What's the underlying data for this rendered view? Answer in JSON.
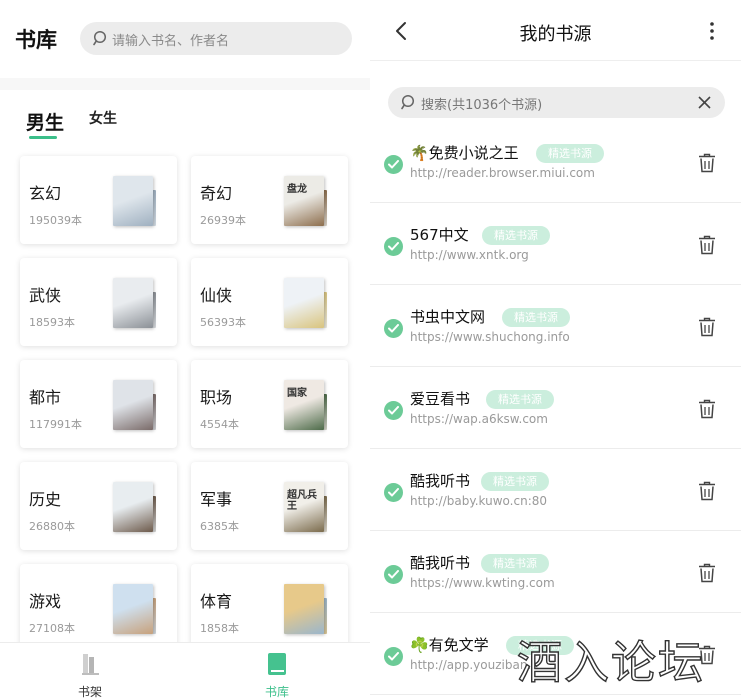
{
  "library": {
    "title": "书库",
    "search_placeholder": "请输入书名、作者名",
    "gender_tabs": {
      "male": "男生",
      "female": "女生"
    },
    "categories": [
      {
        "name": "玄幻",
        "count": "195039本",
        "cover_text": "",
        "colors": [
          "#dfe6ec",
          "#9fb0c0"
        ]
      },
      {
        "name": "奇幻",
        "count": "26939本",
        "cover_text": "盘龙",
        "colors": [
          "#ecebe6",
          "#8d6e4d"
        ]
      },
      {
        "name": "武侠",
        "count": "18593本",
        "cover_text": "",
        "colors": [
          "#e9ecef",
          "#8b9096"
        ]
      },
      {
        "name": "仙侠",
        "count": "56393本",
        "cover_text": "",
        "colors": [
          "#eef2f6",
          "#d9c47e"
        ]
      },
      {
        "name": "都市",
        "count": "117991本",
        "cover_text": "",
        "colors": [
          "#dfe3e8",
          "#7a6b69"
        ]
      },
      {
        "name": "职场",
        "count": "4554本",
        "cover_text": "国家",
        "colors": [
          "#efe9e3",
          "#4d6b49"
        ]
      },
      {
        "name": "历史",
        "count": "26880本",
        "cover_text": "",
        "colors": [
          "#e8edf0",
          "#6d5a4b"
        ]
      },
      {
        "name": "军事",
        "count": "6385本",
        "cover_text": "超凡兵王",
        "colors": [
          "#f1efe9",
          "#7b6b4c"
        ]
      },
      {
        "name": "游戏",
        "count": "27108本",
        "cover_text": "",
        "colors": [
          "#cfe0ef",
          "#c7a17c"
        ]
      },
      {
        "name": "体育",
        "count": "1858本",
        "cover_text": "",
        "colors": [
          "#e7c98a",
          "#9ab6cc"
        ]
      }
    ],
    "nav": {
      "shelf": "书架",
      "library": "书库"
    },
    "accent": "#3bbf8a"
  },
  "sources": {
    "title": "我的书源",
    "search_placeholder": "搜索(共1036个书源)",
    "items": [
      {
        "name": "🌴免费小说之王",
        "tag": "精选书源",
        "url": "http://reader.browser.miui.com"
      },
      {
        "name": "567中文",
        "tag": "精选书源",
        "url": "http://www.xntk.org"
      },
      {
        "name": "书虫中文网",
        "tag": "精选书源",
        "url": "https://www.shuchong.info"
      },
      {
        "name": "爱豆看书",
        "tag": "精选书源",
        "url": "https://wap.a6ksw.com"
      },
      {
        "name": "酷我听书",
        "tag": "精选书源",
        "url": "http://baby.kuwo.cn:80"
      },
      {
        "name": "酷我听书",
        "tag": "精选书源",
        "url": "https://www.kwting.com"
      },
      {
        "name": "☘️有免文学",
        "tag": "精选书源",
        "url": "http://app.youziban..."
      }
    ],
    "icons": {
      "back": "back-chevron-icon",
      "more": "more-vertical-icon",
      "check": "check-circle-icon",
      "delete": "trash-icon",
      "clear": "close-icon"
    }
  },
  "watermark": "酒入论坛"
}
